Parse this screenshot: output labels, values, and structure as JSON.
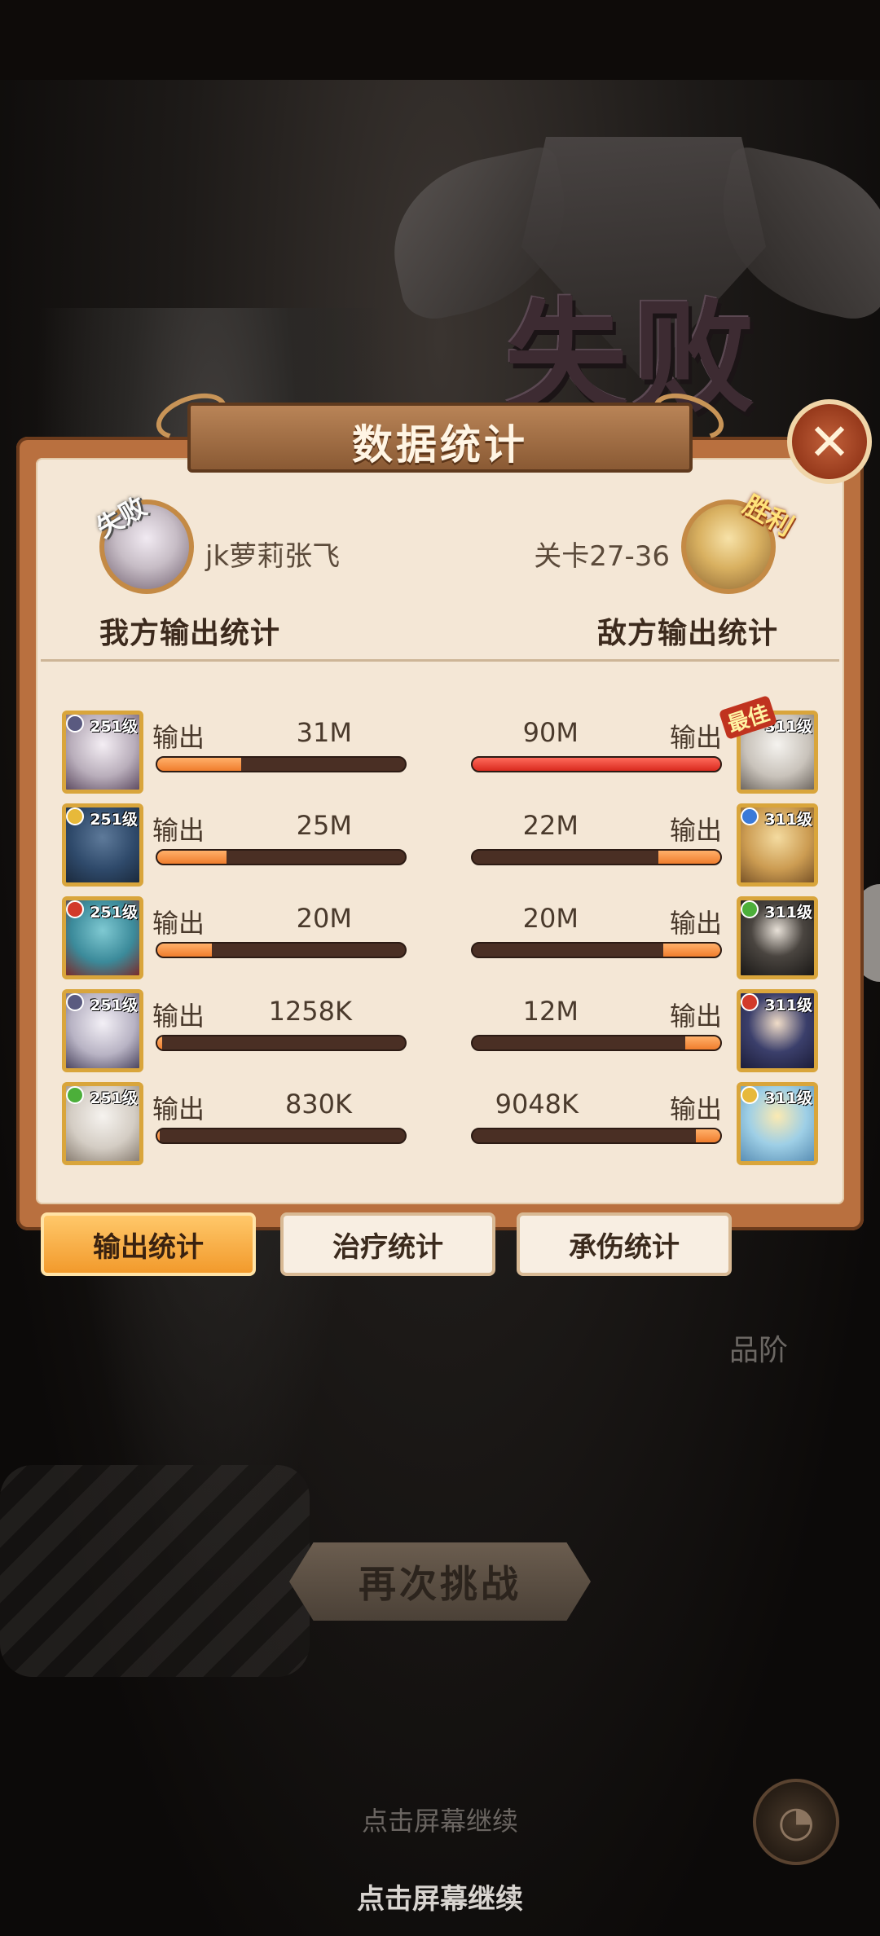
{
  "background": {
    "result_title": "失败",
    "grade_label": "品阶",
    "retry_label": "再次挑战",
    "hint_dim": "点击屏幕继续",
    "hint_main": "点击屏幕继续"
  },
  "panel": {
    "title": "数据统计",
    "close_icon": "✕",
    "left": {
      "result_tag": "失败",
      "player_name": "jk萝莉张飞",
      "section_title": "我方输出统计"
    },
    "right": {
      "result_tag": "胜利",
      "stage_name": "关卡27-36",
      "section_title": "敌方输出统计"
    },
    "best_tag": "最佳",
    "rows": [
      {
        "left": {
          "level": "251级",
          "label": "输出",
          "value": "31M",
          "fill": 0.34
        },
        "right": {
          "level": "311级",
          "label": "输出",
          "value": "90M",
          "fill": 1.0
        }
      },
      {
        "left": {
          "level": "251级",
          "label": "输出",
          "value": "25M",
          "fill": 0.28
        },
        "right": {
          "level": "311级",
          "label": "输出",
          "value": "22M",
          "fill": 0.25
        }
      },
      {
        "left": {
          "level": "251级",
          "label": "输出",
          "value": "20M",
          "fill": 0.22
        },
        "right": {
          "level": "311级",
          "label": "输出",
          "value": "20M",
          "fill": 0.23
        }
      },
      {
        "left": {
          "level": "251级",
          "label": "输出",
          "value": "1258K",
          "fill": 0.02
        },
        "right": {
          "level": "311级",
          "label": "输出",
          "value": "12M",
          "fill": 0.14
        }
      },
      {
        "left": {
          "level": "251级",
          "label": "输出",
          "value": "830K",
          "fill": 0.01
        },
        "right": {
          "level": "311级",
          "label": "输出",
          "value": "9048K",
          "fill": 0.1
        }
      }
    ],
    "tabs": [
      "输出统计",
      "治疗统计",
      "承伤统计"
    ]
  },
  "colors": {
    "bar_fill": "#f07d2d",
    "best_bar_fill": "#d92a1f",
    "panel_frame": "#b9703f",
    "panel_bg": "#f4e7d6"
  }
}
